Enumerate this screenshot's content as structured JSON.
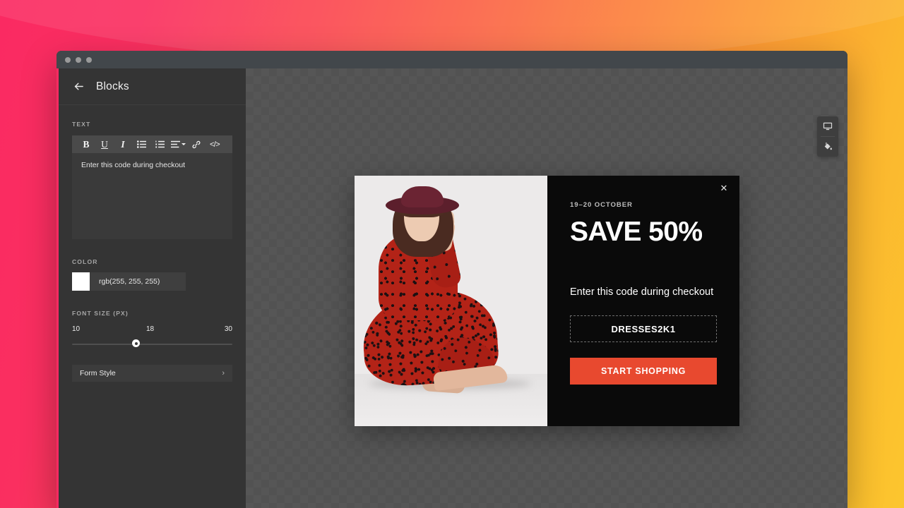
{
  "background": {
    "gradient_start": "#fa2a62",
    "gradient_end": "#fcc62e"
  },
  "window": {
    "traffic_lights": [
      "dot-1",
      "dot-2",
      "dot-3"
    ],
    "accent_color": "#fa2a62"
  },
  "sidebar": {
    "back_icon": "arrow-left-icon",
    "title": "Blocks",
    "text_section": {
      "label": "TEXT",
      "toolbar": [
        {
          "icon": "bold-icon",
          "label": "B"
        },
        {
          "icon": "underline-icon",
          "label": "U"
        },
        {
          "icon": "italic-icon",
          "label": "I"
        },
        {
          "icon": "unordered-list-icon",
          "label": ""
        },
        {
          "icon": "ordered-list-icon",
          "label": ""
        },
        {
          "icon": "align-icon",
          "label": ""
        },
        {
          "icon": "link-icon",
          "label": ""
        },
        {
          "icon": "code-icon",
          "label": "</>"
        }
      ],
      "value": "Enter this code during checkout"
    },
    "color_section": {
      "label": "COLOR",
      "swatch_hex": "#ffffff",
      "value": "rgb(255, 255, 255)"
    },
    "font_size_section": {
      "label": "FONT SIZE (PX)",
      "min": "10",
      "current": "18",
      "max": "30",
      "thumb_percent": 40
    },
    "form_style": {
      "label": "Form Style",
      "chevron": "chevron-right-icon"
    }
  },
  "canvas": {
    "tool_rail": [
      {
        "icon": "desktop-icon"
      },
      {
        "icon": "paint-bucket-icon"
      }
    ]
  },
  "popup": {
    "close_icon": "close-icon",
    "close_label": "✕",
    "kicker": "19–20 OCTOBER",
    "headline": "SAVE 50%",
    "subtext": "Enter this code during checkout",
    "coupon_code": "DRESSES2K1",
    "cta_label": "START SHOPPING",
    "cta_color": "#e8492f",
    "image_alt": "woman-in-red-dress-and-hat"
  }
}
